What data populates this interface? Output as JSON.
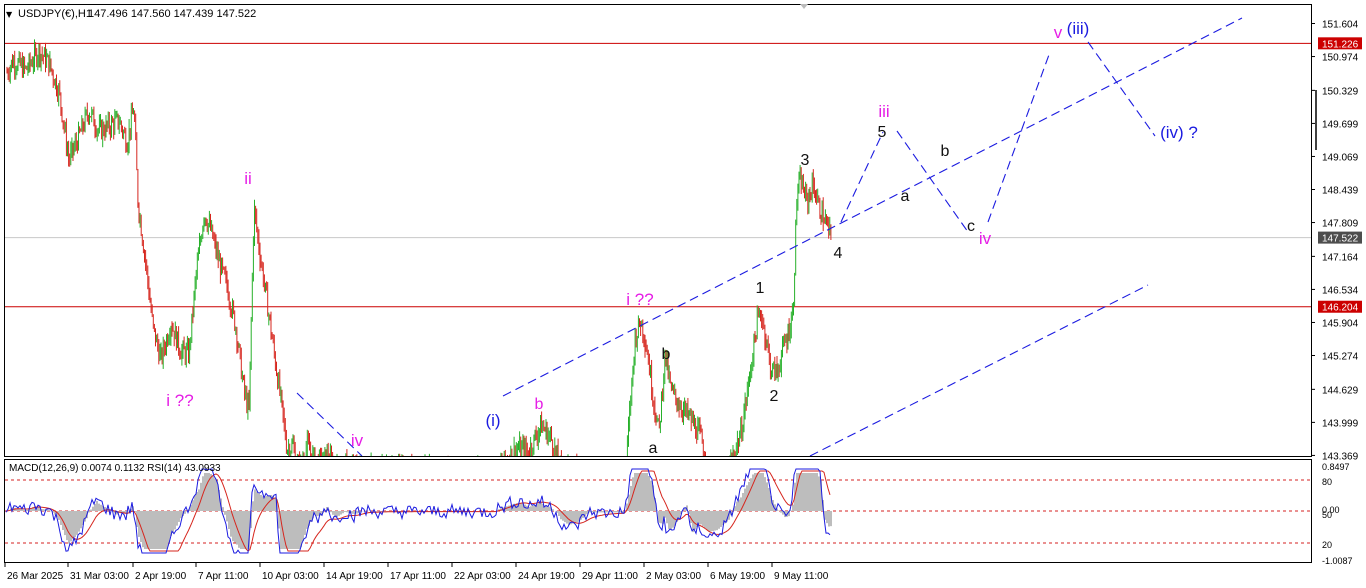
{
  "header": {
    "symbol_label": "USDJPY(€),H1",
    "ohlc_label": "147.496 147.560 147.439 147.522"
  },
  "indicator": {
    "label": "MACD(12,26,9) 0.0074 0.1132  RSI(14) 43.0933",
    "right_ticks": [
      "0.8497",
      "80",
      "0.00",
      "50",
      "20",
      "-1.0087"
    ]
  },
  "colors": {
    "bull": "#27b02a",
    "bear": "#d6261e",
    "wave_blue": "#1b1be0",
    "wave_magenta": "#e61ee6",
    "wave_black": "#111111",
    "hline": "#cc0000",
    "price_tag": "#4d4d4d",
    "macd_hist": "#bdbdbd",
    "signal": "#d6261e",
    "rsi": "#1b1be0"
  },
  "chart_data": {
    "type": "candlestick",
    "symbol": "USDJPY",
    "timeframe": "H1",
    "ylim": [
      142.9,
      152.05
    ],
    "y_ticks": [
      "151.604",
      "150.974",
      "150.329",
      "149.699",
      "149.069",
      "148.439",
      "147.809",
      "147.164",
      "146.534",
      "145.904",
      "145.274",
      "144.629",
      "143.999",
      "143.369"
    ],
    "x_ticks": [
      "26 Mar 2025",
      "31 Mar 03:00",
      "2 Apr 19:00",
      "7 Apr 11:00",
      "10 Apr 03:00",
      "14 Apr 19:00",
      "17 Apr 11:00",
      "22 Apr 03:00",
      "24 Apr 19:00",
      "29 Apr 11:00",
      "2 May 03:00",
      "6 May 19:00",
      "9 May 11:00"
    ],
    "current_price": 147.522,
    "horizontal_lines": [
      151.226,
      146.204
    ],
    "price_path": [
      [
        0,
        150.45
      ],
      [
        12,
        150.9
      ],
      [
        25,
        150.72
      ],
      [
        38,
        151.08
      ],
      [
        48,
        150.85
      ],
      [
        58,
        150.3
      ],
      [
        68,
        149.0
      ],
      [
        78,
        149.45
      ],
      [
        88,
        149.95
      ],
      [
        98,
        149.55
      ],
      [
        108,
        149.65
      ],
      [
        118,
        149.75
      ],
      [
        126,
        149.35
      ],
      [
        133,
        150.0
      ],
      [
        137,
        148.2
      ],
      [
        145,
        147.0
      ],
      [
        152,
        145.8
      ],
      [
        160,
        145.2
      ],
      [
        170,
        145.9
      ],
      [
        180,
        145.35
      ],
      [
        188,
        145.3
      ],
      [
        195,
        146.8
      ],
      [
        203,
        148.0
      ],
      [
        210,
        147.65
      ],
      [
        218,
        147.05
      ],
      [
        226,
        146.6
      ],
      [
        235,
        145.8
      ],
      [
        243,
        144.6
      ],
      [
        248,
        144.2
      ],
      [
        253,
        148.1
      ],
      [
        259,
        147.2
      ],
      [
        266,
        146.3
      ],
      [
        274,
        145.2
      ],
      [
        280,
        144.4
      ],
      [
        286,
        143.5
      ],
      [
        292,
        143.55
      ],
      [
        298,
        143.1
      ],
      [
        306,
        143.55
      ],
      [
        316,
        143.2
      ],
      [
        326,
        143.35
      ],
      [
        336,
        143.1
      ],
      [
        346,
        143.15
      ],
      [
        494,
        143.0
      ],
      [
        500,
        143.2
      ],
      [
        516,
        143.5
      ],
      [
        528,
        143.45
      ],
      [
        540,
        143.95
      ],
      [
        550,
        143.7
      ],
      [
        560,
        143.1
      ],
      [
        624,
        142.9
      ],
      [
        628,
        144.0
      ],
      [
        634,
        145.6
      ],
      [
        640,
        145.95
      ],
      [
        646,
        145.4
      ],
      [
        652,
        144.5
      ],
      [
        658,
        143.8
      ],
      [
        664,
        145.3
      ],
      [
        670,
        144.6
      ],
      [
        680,
        144.3
      ],
      [
        690,
        144.05
      ],
      [
        700,
        143.7
      ],
      [
        708,
        143.0
      ],
      [
        716,
        142.9
      ],
      [
        728,
        143.15
      ],
      [
        740,
        143.8
      ],
      [
        748,
        144.8
      ],
      [
        756,
        145.9
      ],
      [
        760,
        146.1
      ],
      [
        765,
        145.6
      ],
      [
        770,
        145.0
      ],
      [
        776,
        144.95
      ],
      [
        782,
        145.4
      ],
      [
        787,
        145.7
      ],
      [
        792,
        146.1
      ],
      [
        796,
        148.4
      ],
      [
        800,
        148.6
      ],
      [
        806,
        148.2
      ],
      [
        812,
        148.55
      ],
      [
        818,
        148.1
      ],
      [
        824,
        147.85
      ],
      [
        830,
        147.52
      ]
    ]
  },
  "price_scale_tags": {
    "upper_line_label": "151.226",
    "lower_line_label": "146.204",
    "current_label": "147.522"
  },
  "wave_labels": [
    {
      "text": "v",
      "x": 1058,
      "y": 38,
      "color": "wave_magenta",
      "size": 17
    },
    {
      "text": "(iii)",
      "x": 1078,
      "y": 34,
      "color": "wave_blue",
      "size": 17
    },
    {
      "text": "iii",
      "x": 884,
      "y": 117,
      "color": "wave_magenta",
      "size": 17
    },
    {
      "text": "5",
      "x": 882,
      "y": 137,
      "color": "wave_black",
      "size": 16
    },
    {
      "text": "b",
      "x": 945,
      "y": 156,
      "color": "wave_black",
      "size": 16
    },
    {
      "text": "3",
      "x": 805,
      "y": 165,
      "color": "wave_black",
      "size": 16
    },
    {
      "text": "a",
      "x": 905,
      "y": 201,
      "color": "wave_black",
      "size": 16
    },
    {
      "text": "c",
      "x": 971,
      "y": 231,
      "color": "wave_black",
      "size": 16
    },
    {
      "text": "iv",
      "x": 985,
      "y": 244,
      "color": "wave_magenta",
      "size": 17
    },
    {
      "text": "4",
      "x": 838,
      "y": 258,
      "color": "wave_black",
      "size": 16
    },
    {
      "text": "(iv) ?",
      "x": 1179,
      "y": 138,
      "color": "wave_blue",
      "size": 17
    },
    {
      "text": "1",
      "x": 760,
      "y": 293,
      "color": "wave_black",
      "size": 16
    },
    {
      "text": "i ??",
      "x": 640,
      "y": 305,
      "color": "wave_magenta",
      "size": 17
    },
    {
      "text": "b",
      "x": 666,
      "y": 359,
      "color": "wave_black",
      "size": 16
    },
    {
      "text": "2",
      "x": 774,
      "y": 401,
      "color": "wave_black",
      "size": 16
    },
    {
      "text": "b",
      "x": 539,
      "y": 409,
      "color": "wave_magenta",
      "size": 16
    },
    {
      "text": "(i)",
      "x": 493,
      "y": 426,
      "color": "wave_blue",
      "size": 17
    },
    {
      "text": "a",
      "x": 653,
      "y": 453,
      "color": "wave_black",
      "size": 16
    },
    {
      "text": "i ??",
      "x": 180,
      "y": 406,
      "color": "wave_magenta",
      "size": 17
    },
    {
      "text": "ii",
      "x": 248,
      "y": 184,
      "color": "wave_magenta",
      "size": 17
    },
    {
      "text": "iv",
      "x": 357,
      "y": 446,
      "color": "wave_magenta",
      "size": 17
    }
  ]
}
